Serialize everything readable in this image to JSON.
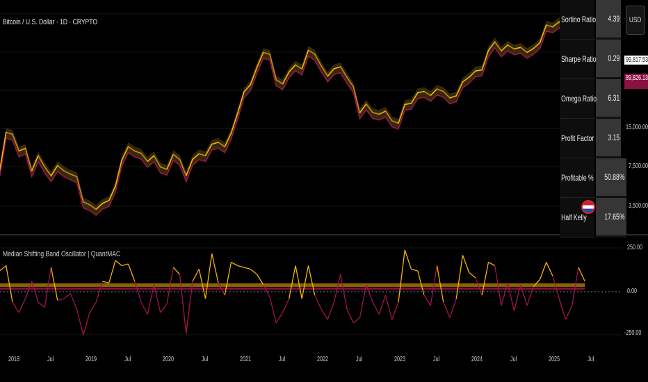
{
  "header": {
    "title": "Bitcoin / U.S. Dollar · 1D · CRYPTO",
    "currency_button": "USD"
  },
  "indicator": {
    "title": "Median Shifting Band Oscillator | QuantMAC"
  },
  "stats_table": [
    {
      "label": "Sortino Ratio",
      "value": "4.39"
    },
    {
      "label": "Sharpe Ratio",
      "value": "0.29"
    },
    {
      "label": "Omega Ratio",
      "value": "6.31"
    },
    {
      "label": "Profit Factor",
      "value": "3.15"
    },
    {
      "label": "Profitable %",
      "value": "50.88%"
    },
    {
      "label": "Half Kelly",
      "value": "17.65%"
    }
  ],
  "price_labels": {
    "current": "99,817.53",
    "band": "89,826.13"
  },
  "colors": {
    "bull": "#f7b500",
    "bear": "#a3144f",
    "band_fill": "#4a3a12",
    "background": "#000000"
  },
  "chart_data": [
    {
      "type": "line",
      "scale": "log",
      "y_ticks": [
        "15,000.00",
        "7,500.00",
        "3,500.00"
      ],
      "y_tick_values": [
        15000,
        7500,
        3500
      ],
      "x_start": "2017-11",
      "x_step": "month",
      "x_tick_labels": [
        "2018",
        "Jul",
        "2019",
        "Jul",
        "2020",
        "Jul",
        "2021",
        "Jul",
        "2022",
        "Jul",
        "2023",
        "Jul",
        "2024",
        "Jul",
        "2025",
        "Jul"
      ],
      "values": [
        7000,
        14000,
        13500,
        10000,
        10500,
        7000,
        9200,
        7500,
        6400,
        7700,
        7000,
        6600,
        6300,
        4000,
        3800,
        3500,
        3900,
        4100,
        5300,
        8500,
        10800,
        10000,
        9600,
        8300,
        9200,
        7500,
        7200,
        9400,
        8600,
        6400,
        8600,
        9500,
        9200,
        11300,
        11700,
        10800,
        13800,
        19700,
        29000,
        33000,
        45000,
        59000,
        57000,
        36000,
        33500,
        41500,
        47100,
        43800,
        61300,
        57000,
        46300,
        38500,
        44000,
        45500,
        37700,
        31800,
        19900,
        23300,
        20000,
        19400,
        20500,
        17200,
        16500,
        23100,
        23600,
        28500,
        29200,
        27200,
        30500,
        29200,
        26000,
        27000,
        34700,
        37700,
        42300,
        43000,
        61000,
        71300,
        60600,
        67500,
        62700,
        64600,
        59000,
        63300,
        70200,
        96400,
        93400,
        102400,
        84300,
        82500,
        94200
      ]
    },
    {
      "type": "line",
      "name": "Median Shifting Band Oscillator | QuantMAC",
      "y_ticks": [
        "250.00",
        "0.00",
        "-250.00"
      ],
      "y_tick_values": [
        250,
        0,
        -250
      ],
      "ylim": [
        -250,
        250
      ],
      "threshold": 40,
      "values": [
        120,
        150,
        -60,
        -120,
        -40,
        60,
        -60,
        -90,
        140,
        -50,
        -40,
        -10,
        -100,
        -250,
        -120,
        -60,
        60,
        50,
        180,
        150,
        160,
        60,
        -60,
        -130,
        40,
        -120,
        -70,
        140,
        100,
        -240,
        60,
        130,
        -40,
        220,
        50,
        -20,
        170,
        150,
        140,
        130,
        100,
        40,
        -30,
        -180,
        -120,
        -40,
        150,
        -40,
        150,
        -20,
        -100,
        -160,
        -60,
        100,
        -100,
        -180,
        -150,
        40,
        -60,
        -130,
        -20,
        -160,
        -60,
        240,
        130,
        120,
        -20,
        -80,
        150,
        -60,
        -150,
        -40,
        210,
        110,
        80,
        -20,
        170,
        150,
        -80,
        50,
        -110,
        40,
        -80,
        30,
        70,
        170,
        90,
        -40,
        -160,
        -80,
        140,
        60
      ]
    }
  ]
}
